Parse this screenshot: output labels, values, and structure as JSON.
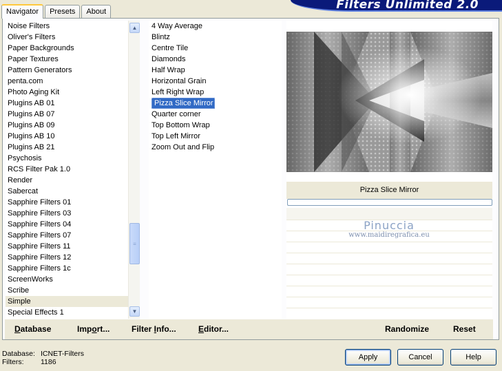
{
  "tabs": [
    {
      "label": "Navigator",
      "active": true
    },
    {
      "label": "Presets",
      "active": false
    },
    {
      "label": "About",
      "active": false
    }
  ],
  "banner": {
    "title": "Filters Unlimited 2.0"
  },
  "categories": {
    "items": [
      "Noise Filters",
      "Oliver's Filters",
      "Paper Backgrounds",
      "Paper Textures",
      "Pattern Generators",
      "penta.com",
      "Photo Aging Kit",
      "Plugins AB 01",
      "Plugins AB 07",
      "Plugins AB 09",
      "Plugins AB 10",
      "Plugins AB 21",
      "Psychosis",
      "RCS Filter Pak 1.0",
      "Render",
      "Sabercat",
      "Sapphire Filters 01",
      "Sapphire Filters 03",
      "Sapphire Filters 04",
      "Sapphire Filters 07",
      "Sapphire Filters 11",
      "Sapphire Filters 12",
      "Sapphire Filters 1c",
      "ScreenWorks",
      "Scribe",
      "Simple",
      "Special Effects 1"
    ],
    "selected": "Simple"
  },
  "filters": {
    "items": [
      "4 Way Average",
      "Blintz",
      "Centre Tile",
      "Diamonds",
      "Half Wrap",
      "Horizontal Grain",
      "Left Right Wrap",
      "Pizza Slice Mirror",
      "Quarter corner",
      "Top Bottom Wrap",
      "Top Left Mirror",
      "Zoom Out and Flip"
    ],
    "selected": "Pizza Slice Mirror"
  },
  "preview": {
    "filter_name": "Pizza Slice Mirror"
  },
  "watermark": {
    "title": "Pinuccia",
    "url": "www.maidiregrafica.eu"
  },
  "toolbar": {
    "database": {
      "u": "D",
      "rest": "atabase"
    },
    "import": {
      "pre": "Imp",
      "u": "o",
      "rest": "rt..."
    },
    "filter_info": {
      "pre": "Filter ",
      "u": "I",
      "rest": "nfo..."
    },
    "editor": {
      "u": "E",
      "rest": "ditor..."
    },
    "randomize": "Randomize",
    "reset": "Reset"
  },
  "status": {
    "database_label": "Database:",
    "database_value": "ICNET-Filters",
    "filters_label": "Filters:",
    "filters_value": "1186"
  },
  "buttons": {
    "apply": "Apply",
    "cancel": "Cancel",
    "help": "Help"
  },
  "colors": {
    "selection": "#316ac5",
    "banner": "#0a1a7a",
    "dialog_bg": "#ece9d8"
  },
  "icons": {
    "scroll_up": "chevron-up-icon",
    "scroll_down": "chevron-down-icon",
    "scroll_grip": "grip-icon"
  }
}
